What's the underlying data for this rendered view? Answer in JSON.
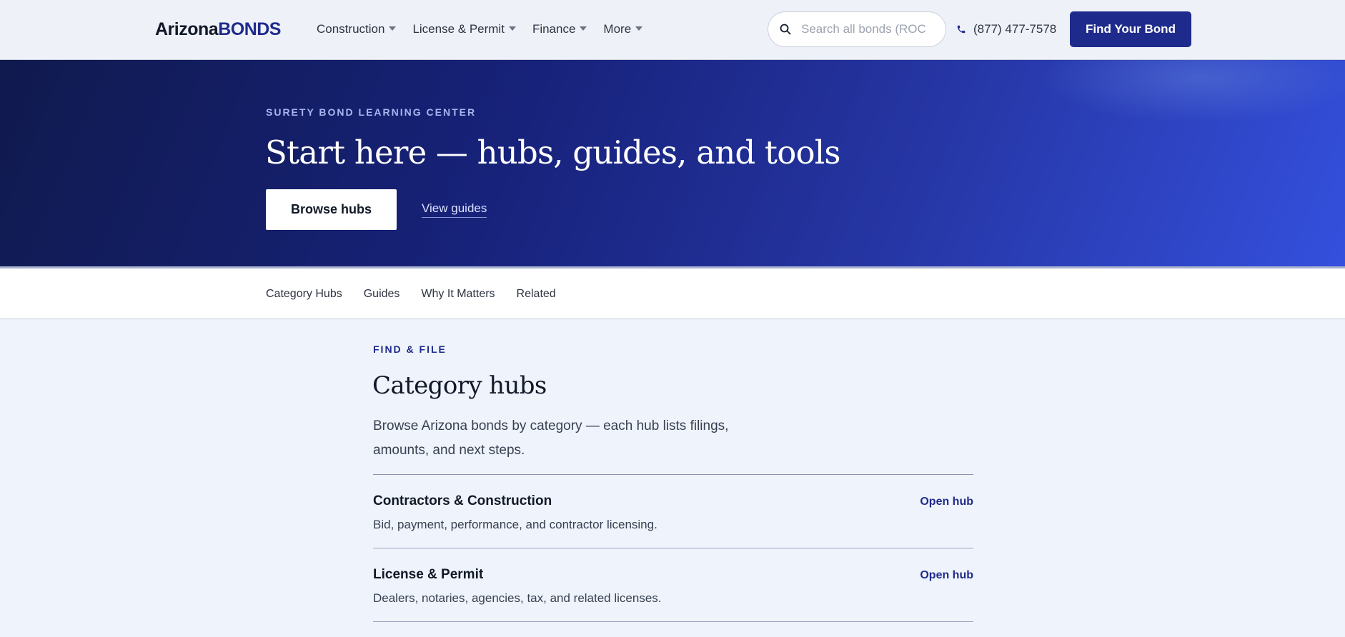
{
  "header": {
    "logo_part1": "Arizona",
    "logo_part2": "BONDS",
    "nav": [
      {
        "label": "Construction"
      },
      {
        "label": "License & Permit"
      },
      {
        "label": "Finance"
      },
      {
        "label": "More"
      }
    ],
    "search_placeholder": "Search all bonds (ROC",
    "phone": "(877) 477-7578",
    "cta": "Find Your Bond"
  },
  "hero": {
    "eyebrow": "SURETY BOND LEARNING CENTER",
    "title": "Start here — hubs, guides, and tools",
    "primary_button": "Browse hubs",
    "secondary_link": "View guides"
  },
  "subnav": [
    {
      "label": "Category Hubs"
    },
    {
      "label": "Guides"
    },
    {
      "label": "Why It Matters"
    },
    {
      "label": "Related"
    }
  ],
  "section": {
    "eyebrow": "FIND & FILE",
    "title": "Category hubs",
    "description": "Browse Arizona bonds by category — each hub lists filings, amounts, and next steps.",
    "hubs": [
      {
        "title": "Contractors & Construction",
        "desc": "Bid, payment, performance, and contractor licensing.",
        "action": "Open hub"
      },
      {
        "title": "License & Permit",
        "desc": "Dealers, notaries, agencies, tax, and related licenses.",
        "action": "Open hub"
      }
    ]
  },
  "colors": {
    "brand": "#1f2b8c",
    "hero_start": "#101a4e",
    "hero_end": "#3450dd",
    "page_bg": "#eff3fb"
  }
}
